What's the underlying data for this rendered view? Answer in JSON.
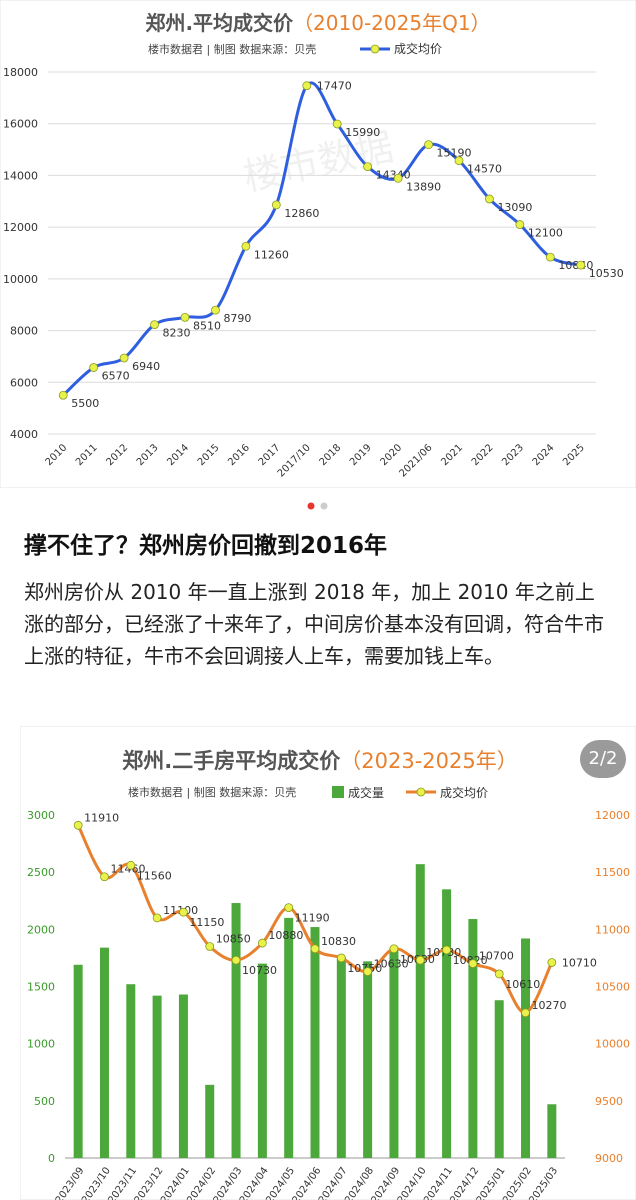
{
  "article": {
    "title": "撑不住了？郑州房价回撤到2016年",
    "body": "郑州房价从 2010 年一直上涨到 2018 年，加上 2010 年之前上涨的部分，已经涨了十来年了，中间房价基本没有回调，符合牛市上涨的特征，牛市不会回调接人上车，需要加钱上车。"
  },
  "carousel": {
    "page_indicator": "2/2",
    "dot_count": 2,
    "active_dot": 1
  },
  "colors": {
    "line_blue": "#2f5fe0",
    "marker_yellow": "#e8f24a",
    "bar_green": "#4ca83a",
    "line_orange": "#e8802e",
    "title_orange": "#e8802e",
    "left_axis_green": "#3a9a2a"
  },
  "chart_data": [
    {
      "type": "line",
      "title_main": "郑州.平均成交价",
      "title_period": "（2010-2025年Q1）",
      "subtitle": "楼市数据君 | 制图    数据来源：贝壳",
      "legend": "成交均价",
      "legend_position": "top-right",
      "watermark": "楼市数据",
      "categories": [
        "2010",
        "2011",
        "2012",
        "2013",
        "2014",
        "2015",
        "2016",
        "2017",
        "2017/10",
        "2018",
        "2019",
        "2020",
        "2021/06",
        "2021",
        "2022",
        "2023",
        "2024",
        "2025"
      ],
      "series": [
        {
          "name": "成交均价",
          "values": [
            5500,
            6570,
            6940,
            8230,
            8510,
            8790,
            11260,
            12860,
            17470,
            15990,
            14340,
            13890,
            15190,
            14570,
            13090,
            12100,
            10840,
            10530
          ]
        }
      ],
      "ylim": [
        4000,
        18000
      ],
      "yticks": [
        4000,
        6000,
        8000,
        10000,
        12000,
        14000,
        16000,
        18000
      ],
      "grid": true
    },
    {
      "type": "bar+line",
      "title_main": "郑州.二手房平均成交价",
      "title_period": "（2023-2025年）",
      "subtitle": "楼市数据君 | 制图    数据来源：贝壳",
      "legend_position": "top-right",
      "categories": [
        "2023/09",
        "2023/10",
        "2023/11",
        "2023/12",
        "2024/01",
        "2024/02",
        "2024/03",
        "2024/04",
        "2024/05",
        "2024/06",
        "2024/07",
        "2024/08",
        "2024/09",
        "2024/10",
        "2024/11",
        "2024/12",
        "2025/01",
        "2025/02",
        "2025/03"
      ],
      "series": [
        {
          "name": "成交量",
          "axis": "left",
          "values": [
            1690,
            1840,
            1520,
            1420,
            1430,
            640,
            2230,
            1700,
            2100,
            2020,
            1760,
            1720,
            1840,
            2570,
            2350,
            2090,
            1380,
            1920,
            470
          ]
        },
        {
          "name": "成交均价",
          "axis": "right",
          "values": [
            11910,
            11460,
            11560,
            11100,
            11150,
            10850,
            10730,
            10880,
            11190,
            10830,
            10750,
            10630,
            10830,
            10730,
            10820,
            10700,
            10610,
            10270,
            10710
          ]
        }
      ],
      "ylim_left": [
        0,
        3000
      ],
      "yticks_left": [
        0,
        500,
        1000,
        1500,
        2000,
        2500,
        3000
      ],
      "ylim_right": [
        9000,
        12000
      ],
      "yticks_right": [
        9000,
        9500,
        10000,
        10500,
        11000,
        11500,
        12000
      ],
      "grid": false
    }
  ]
}
